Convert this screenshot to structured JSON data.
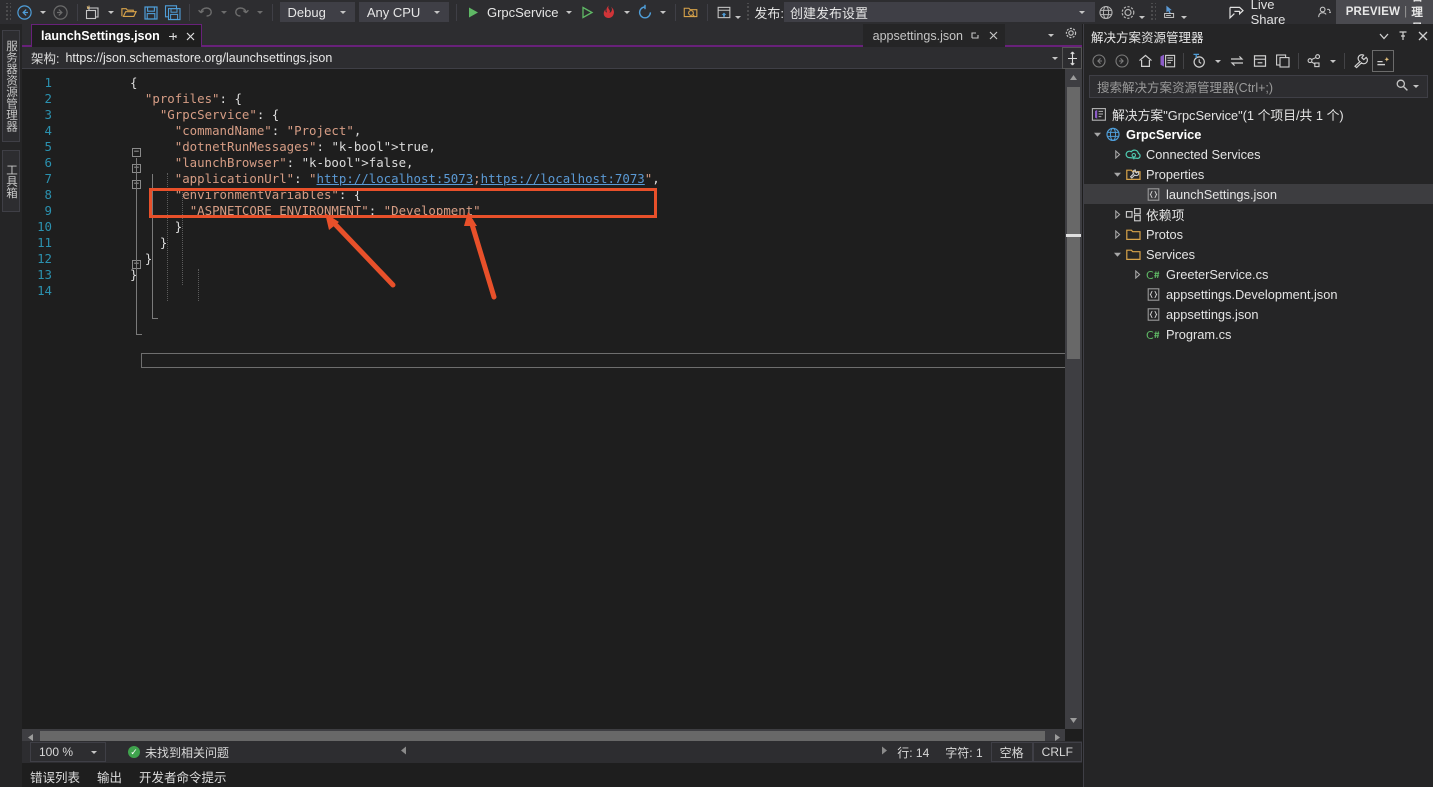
{
  "toolbar": {
    "nav_back": "navigate-back",
    "nav_forward": "navigate-forward",
    "new_project": "new-project",
    "open_file": "open-file",
    "save": "save",
    "save_all": "save-all",
    "undo": "undo",
    "redo": "redo",
    "config_value": "Debug",
    "platform_value": "Any CPU",
    "start_label": "GrpcService",
    "publish_label": "发布:",
    "publish_value": "创建发布设置",
    "live_share": "Live Share",
    "preview_text": "PREVIEW",
    "preview_sep": "|",
    "preview_admin": "管理员"
  },
  "leftrail": {
    "server_explorer": "服务器资源管理器",
    "toolbox": "工具箱"
  },
  "editor": {
    "active_tab": "launchSettings.json",
    "inactive_tab": "appsettings.json",
    "schema_label": "架构:",
    "schema_value": "https://json.schemastore.org/launchsettings.json",
    "lines": [
      {
        "n": "1",
        "text": "{"
      },
      {
        "n": "2",
        "text": "  \"profiles\": {"
      },
      {
        "n": "3",
        "text": "    \"GrpcService\": {"
      },
      {
        "n": "4",
        "text": "      \"commandName\": \"Project\","
      },
      {
        "n": "5",
        "text": "      \"dotnetRunMessages\": true,"
      },
      {
        "n": "6",
        "text": "      \"launchBrowser\": false,"
      },
      {
        "n": "7",
        "text": "      \"applicationUrl\": \"http://localhost:5073;https://localhost:7073\","
      },
      {
        "n": "8",
        "text": "      \"environmentVariables\": {"
      },
      {
        "n": "9",
        "text": "        \"ASPNETCORE_ENVIRONMENT\": \"Development\""
      },
      {
        "n": "10",
        "text": "      }"
      },
      {
        "n": "11",
        "text": "    }"
      },
      {
        "n": "12",
        "text": "  }"
      },
      {
        "n": "13",
        "text": "}"
      },
      {
        "n": "14",
        "text": ""
      }
    ],
    "url_http": "http://localhost:5073",
    "url_https": "https://localhost:7073"
  },
  "annotation": {
    "color": "#e8502a",
    "highlight_target": "applicationUrl line",
    "arrow_count": 2
  },
  "status": {
    "zoom": "100 %",
    "problems": "未找到相关问题",
    "line_label": "行: 14",
    "char_label": "字符: 1",
    "spaces": "空格",
    "eol": "CRLF"
  },
  "bottom_tabs": [
    "错误列表",
    "输出",
    "开发者命令提示"
  ],
  "solution_explorer": {
    "title": "解决方案资源管理器",
    "search_placeholder": "搜索解决方案资源管理器(Ctrl+;)",
    "solution_row": "解决方案\"GrpcService\"(1 个项目/共 1 个)",
    "tree": [
      {
        "label": "GrpcService",
        "indent": 0,
        "chev": "down",
        "icon": "project-icon",
        "bold": true,
        "selected": false
      },
      {
        "label": "Connected Services",
        "indent": 1,
        "chev": "right",
        "icon": "connected-icon",
        "bold": false,
        "selected": false
      },
      {
        "label": "Properties",
        "indent": 1,
        "chev": "down",
        "icon": "props-icon",
        "bold": false,
        "selected": false
      },
      {
        "label": "launchSettings.json",
        "indent": 2,
        "chev": "none",
        "icon": "json-icon",
        "bold": false,
        "selected": true
      },
      {
        "label": "依赖项",
        "indent": 1,
        "chev": "right",
        "icon": "deps-icon",
        "bold": false,
        "selected": false
      },
      {
        "label": "Protos",
        "indent": 1,
        "chev": "right",
        "icon": "folder-icon",
        "bold": false,
        "selected": false
      },
      {
        "label": "Services",
        "indent": 1,
        "chev": "down",
        "icon": "folder-icon",
        "bold": false,
        "selected": false
      },
      {
        "label": "GreeterService.cs",
        "indent": 2,
        "chev": "right",
        "icon": "csharp-icon",
        "bold": false,
        "selected": false
      },
      {
        "label": "appsettings.Development.json",
        "indent": 2,
        "chev": "none",
        "icon": "json-icon",
        "bold": false,
        "selected": false
      },
      {
        "label": "appsettings.json",
        "indent": 2,
        "chev": "none",
        "icon": "json-icon",
        "bold": false,
        "selected": false
      },
      {
        "label": "Program.cs",
        "indent": 2,
        "chev": "none",
        "icon": "csharp-icon",
        "bold": false,
        "selected": false
      }
    ]
  },
  "colors": {
    "accent_purple": "#68217a",
    "annotation_red": "#e8502a",
    "link_blue": "#5b9ad5",
    "string_orange": "#d69d85",
    "keyword_blue": "#569cd6",
    "linenum_blue": "#2b91af",
    "bg_editor": "#1e1e1e",
    "bg_chrome": "#2d2d30"
  }
}
